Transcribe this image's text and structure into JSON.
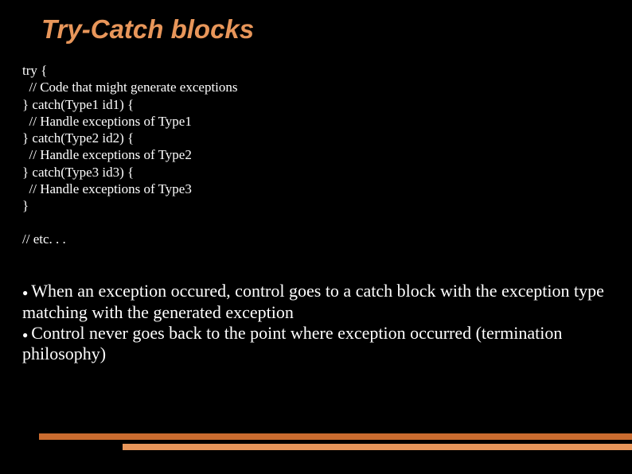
{
  "title": "Try-Catch blocks",
  "code": {
    "line1": "try {",
    "line2": "  // Code that might generate exceptions",
    "line3": "} catch(Type1 id1) {",
    "line4": "  // Handle exceptions of Type1",
    "line5": "} catch(Type2 id2) {",
    "line6": "  // Handle exceptions of Type2",
    "line7": "} catch(Type3 id3) {",
    "line8": "  // Handle exceptions of Type3",
    "line9": "}"
  },
  "etc": "// etc. . .",
  "bullets": {
    "b1": "When an exception occured, control goes to a catch block with the exception type matching with the generated exception",
    "b2": "Control never goes back to the point where exception occurred (termination philosophy)"
  }
}
